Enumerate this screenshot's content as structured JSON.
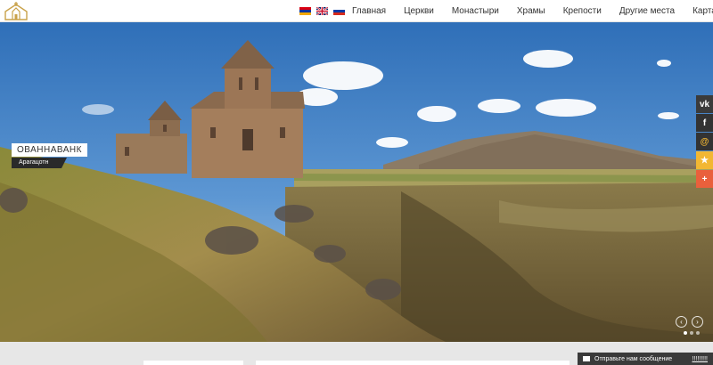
{
  "nav": {
    "items": [
      "Главная",
      "Церкви",
      "Монастыри",
      "Храмы",
      "Крепости",
      "Другие места",
      "Карта сайта"
    ]
  },
  "languages": [
    "armenian-flag",
    "uk-flag",
    "russian-flag"
  ],
  "slide": {
    "title": "ОВАННАВАНК",
    "subtitle": "Арагацотн"
  },
  "social": {
    "vk": "vk",
    "fb": "f",
    "mail": "@",
    "star": "★",
    "plus": "+"
  },
  "slider": {
    "prev": "‹",
    "next": "›"
  },
  "message_bar": {
    "label": "Отправьте нам сообщение",
    "up": "!!!!!!!!!"
  },
  "colors": {
    "accent": "#f2b733",
    "plus": "#e9603c",
    "dark": "#333333"
  }
}
